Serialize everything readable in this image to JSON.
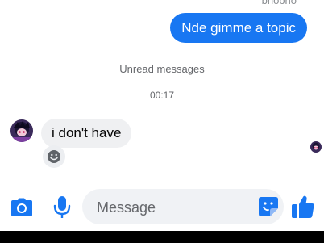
{
  "conversation": {
    "previous_message_fragment": "bnobno",
    "outgoing_message": "Nde gimme a topic",
    "divider_label": "Unread messages",
    "timestamp": "00:17",
    "incoming_message": "i don't have"
  },
  "composer": {
    "placeholder": "Message",
    "value": ""
  },
  "icons": {
    "camera": "camera-icon",
    "microphone": "microphone-icon",
    "sticker": "sticker-icon",
    "like": "thumbs-up-icon",
    "reaction": "smiley-icon"
  },
  "colors": {
    "accent": "#1877f2",
    "bubble_outgoing": "#1877f2",
    "bubble_incoming": "#eff0f2",
    "input_background": "#f0f2f5",
    "meta_text": "#65676b"
  }
}
